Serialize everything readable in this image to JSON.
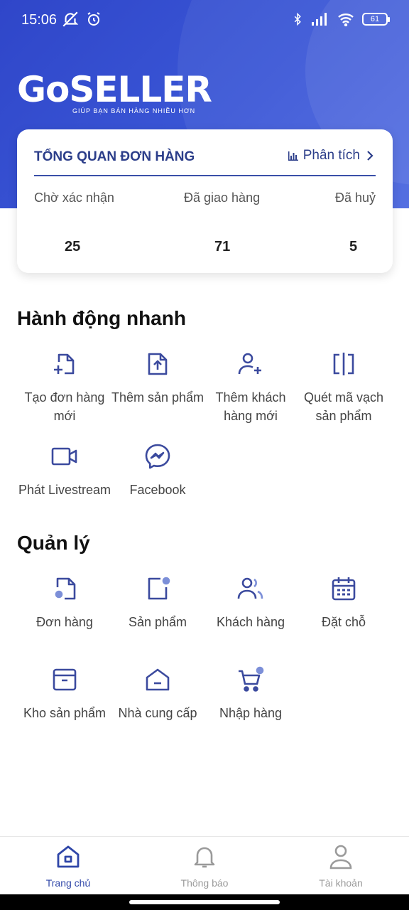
{
  "status_bar": {
    "time": "15:06",
    "battery": "61"
  },
  "logo": {
    "text": "GoSELLER",
    "tagline": "GIÚP BẠN BÁN HÀNG NHIỀU HƠN"
  },
  "overview": {
    "title": "TỔNG QUAN ĐƠN HÀNG",
    "analytics_label": "Phân tích",
    "stats": [
      {
        "label": "Chờ xác nhận",
        "value": "25"
      },
      {
        "label": "Đã giao hàng",
        "value": "71"
      },
      {
        "label": "Đã huỷ",
        "value": "5"
      }
    ]
  },
  "quick_actions": {
    "title": "Hành động nhanh",
    "items": [
      {
        "label": "Tạo đơn hàng mới",
        "icon": "file-plus-icon"
      },
      {
        "label": "Thêm sản phẩm",
        "icon": "upload-file-icon"
      },
      {
        "label": "Thêm khách hàng mới",
        "icon": "user-plus-icon"
      },
      {
        "label": "Quét mã vạch sản phẩm",
        "icon": "barcode-scan-icon"
      },
      {
        "label": "Phát Livestream",
        "icon": "video-icon"
      },
      {
        "label": "Facebook",
        "icon": "messenger-icon"
      }
    ]
  },
  "management": {
    "title": "Quản lý",
    "items": [
      {
        "label": "Đơn hàng",
        "icon": "order-settings-icon"
      },
      {
        "label": "Sản phẩm",
        "icon": "product-settings-icon"
      },
      {
        "label": "Khách hàng",
        "icon": "users-icon"
      },
      {
        "label": "Đặt chỗ",
        "icon": "calendar-icon"
      },
      {
        "label": "Kho sản phẩm",
        "icon": "archive-icon"
      },
      {
        "label": "Nhà cung cấp",
        "icon": "warehouse-icon"
      },
      {
        "label": "Nhập hàng",
        "icon": "cart-settings-icon"
      }
    ]
  },
  "bottom_nav": [
    {
      "label": "Trang chủ",
      "icon": "home-icon",
      "active": true
    },
    {
      "label": "Thông báo",
      "icon": "bell-icon",
      "active": false
    },
    {
      "label": "Tài khoản",
      "icon": "user-icon",
      "active": false
    }
  ],
  "colors": {
    "primary": "#3a56d6",
    "accent": "#3a4fa8",
    "icon": "#3b4a9e",
    "inactive": "#9a9a9a"
  }
}
